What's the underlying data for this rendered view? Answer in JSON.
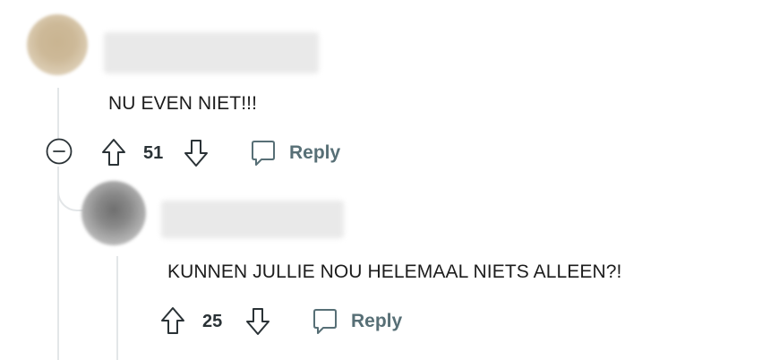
{
  "comments": [
    {
      "text": "NU EVEN NIET!!!",
      "score": "51",
      "reply_label": "Reply"
    },
    {
      "text": "KUNNEN JULLIE NOU HELEMAAL NIETS ALLEEN?!",
      "score": "25",
      "reply_label": "Reply"
    }
  ],
  "colors": {
    "text": "#1c1c1c",
    "action": "#576f76",
    "thread": "#e3e6e8"
  }
}
